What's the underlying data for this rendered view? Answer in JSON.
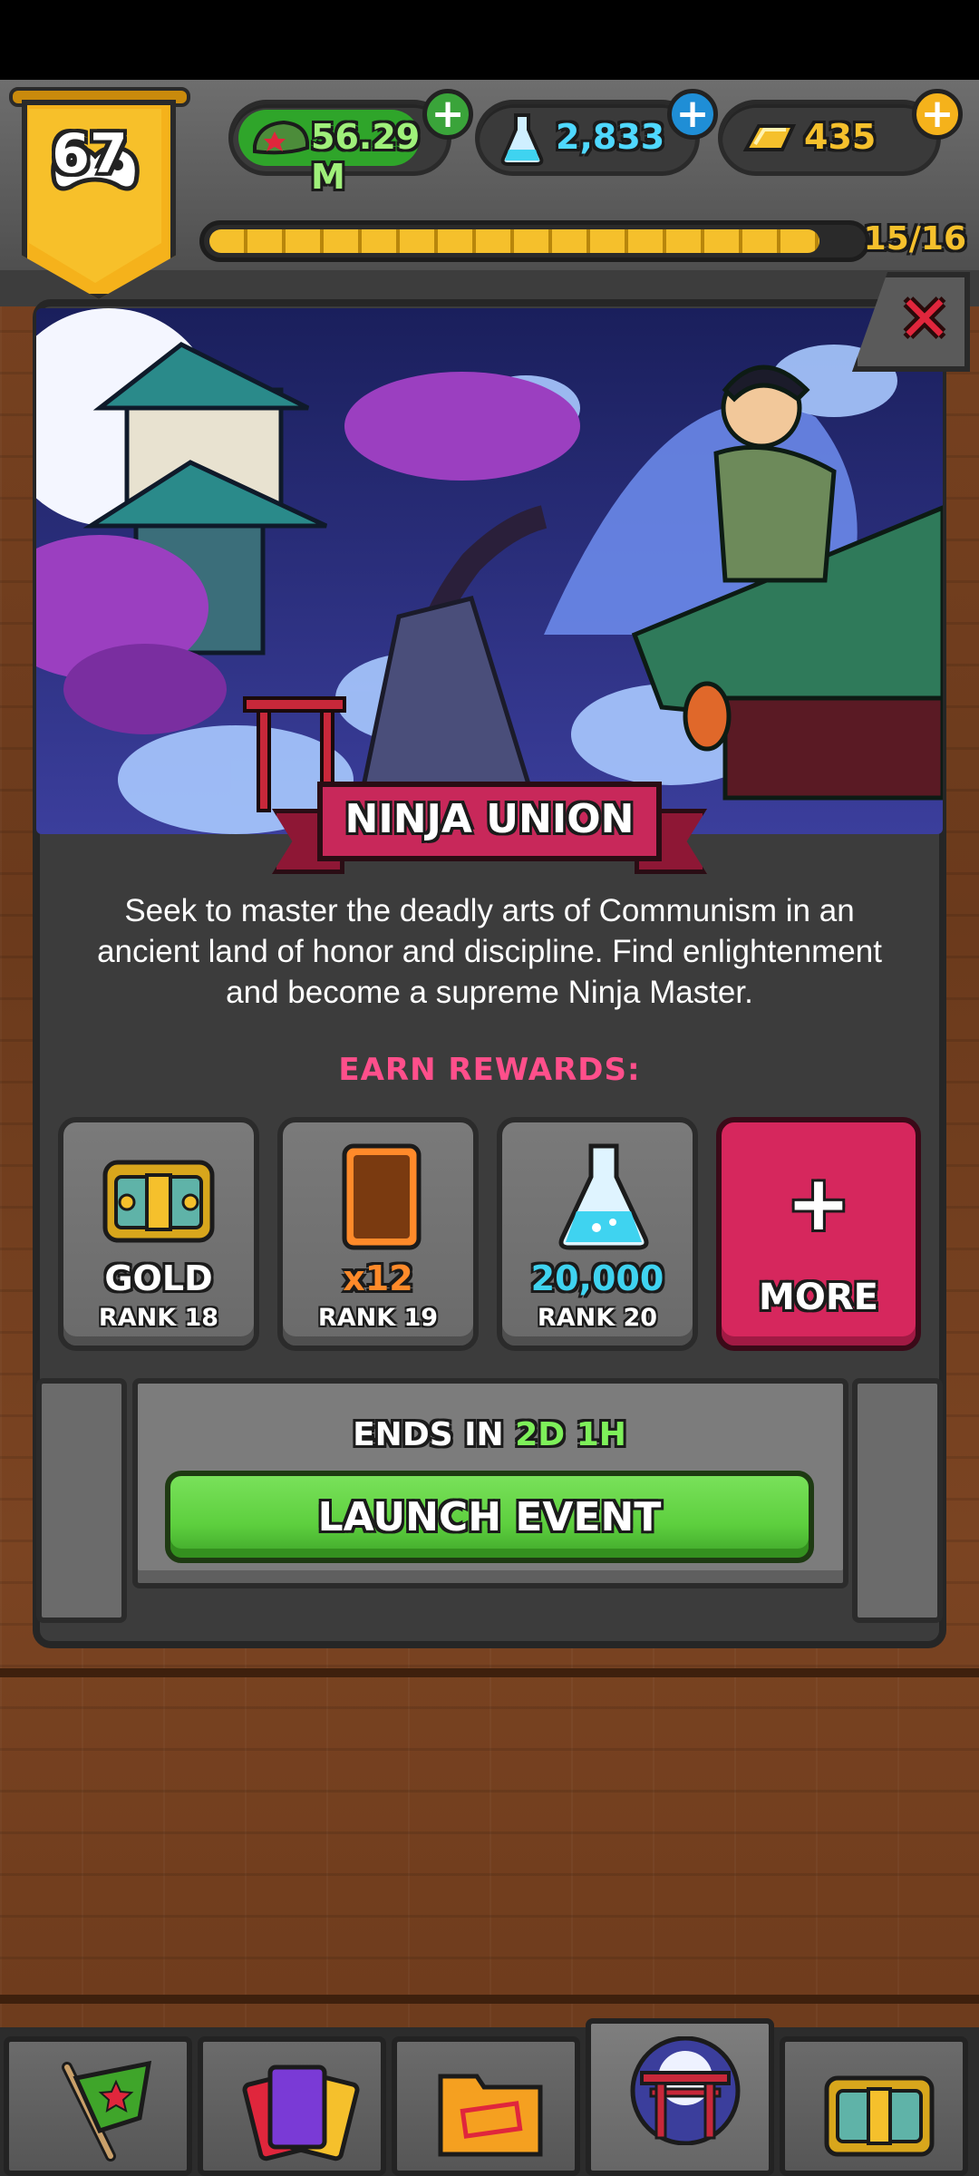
{
  "hud": {
    "level": "67",
    "cash": "56.29 M",
    "science": "2,833",
    "gold": "435",
    "progress_label": "15/16",
    "progress_fraction": 0.9375
  },
  "event": {
    "title": "NINJA UNION",
    "description": "Seek to master the deadly arts of Communism in an ancient land of honor and discipline. Find enlightenment and become a supreme Ninja Master.",
    "earn_label": "EARN REWARDS:",
    "rewards": [
      {
        "value": "GOLD",
        "rank": "RANK 18",
        "value_color": "#ffffff",
        "icon": "gold-chest-icon"
      },
      {
        "value": "x12",
        "rank": "RANK 19",
        "value_color": "#ff8a2a",
        "icon": "card-icon"
      },
      {
        "value": "20,000",
        "rank": "RANK 20",
        "value_color": "#3fd3f0",
        "icon": "flask-icon"
      }
    ],
    "more_label": "MORE",
    "ends_prefix": "ENDS IN",
    "ends_days": "2D",
    "ends_hours": "1H",
    "launch_label": "LAUNCH EVENT"
  },
  "nav": {
    "tabs": [
      {
        "icon": "flag-icon"
      },
      {
        "icon": "cards-icon"
      },
      {
        "icon": "folder-icon"
      },
      {
        "icon": "torii-gate-icon"
      },
      {
        "icon": "chest-icon"
      }
    ],
    "active_index": 3
  },
  "colors": {
    "accent_pink": "#d6275d",
    "launch_green": "#5dcf3e",
    "banner_gold": "#f5b21b"
  }
}
